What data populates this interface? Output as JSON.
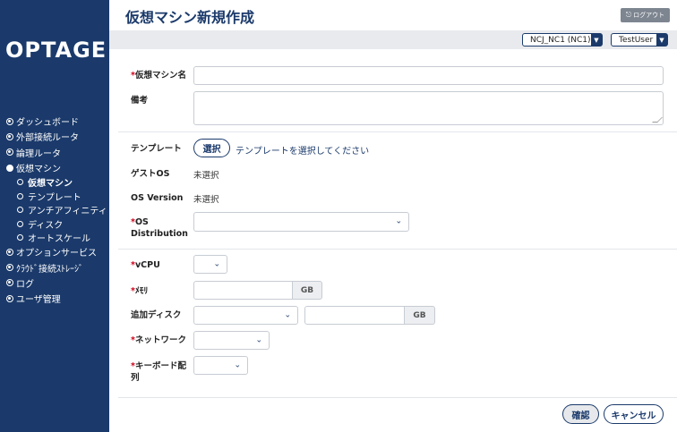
{
  "logo": "OPTAGE",
  "page_title": "仮想マシン新規作成",
  "logout_label": "ログアウト",
  "zone_select": "NCJ_NC1 (NC1)",
  "user_select": "TestUser",
  "sidebar": {
    "items": [
      {
        "label": "ダッシュボード"
      },
      {
        "label": "外部接続ルータ"
      },
      {
        "label": "論理ルータ"
      },
      {
        "label": "仮想マシン"
      },
      {
        "label": "オプションサービス"
      },
      {
        "label": "ｸﾗｳﾄﾞ接続ｽﾄﾚｰｼﾞ"
      },
      {
        "label": "ログ"
      },
      {
        "label": "ユーザ管理"
      }
    ],
    "sub_items": [
      {
        "label": "仮想マシン"
      },
      {
        "label": "テンプレート"
      },
      {
        "label": "アンチアフィニティ"
      },
      {
        "label": "ディスク"
      },
      {
        "label": "オートスケール"
      }
    ]
  },
  "form": {
    "required_mark": "*",
    "vm_name_label": "仮想マシン名",
    "note_label": "備考",
    "template_label": "テンプレート",
    "template_select_button": "選択",
    "template_hint": "テンプレートを選択してください",
    "guest_os_label": "ゲストOS",
    "guest_os_value": "未選択",
    "os_version_label": "OS Version",
    "os_version_value": "未選択",
    "os_dist_label_1": "OS",
    "os_dist_label_2": "Distribution",
    "vcpu_label": "vCPU",
    "memory_label": "ﾒﾓﾘ",
    "memory_unit": "GB",
    "extra_disk_label": "追加ディスク",
    "extra_disk_unit": "GB",
    "network_label": "ネットワーク",
    "keyboard_label_1": "キーボード配",
    "keyboard_label_2": "列"
  },
  "buttons": {
    "confirm": "確認",
    "cancel": "キャンセル"
  }
}
